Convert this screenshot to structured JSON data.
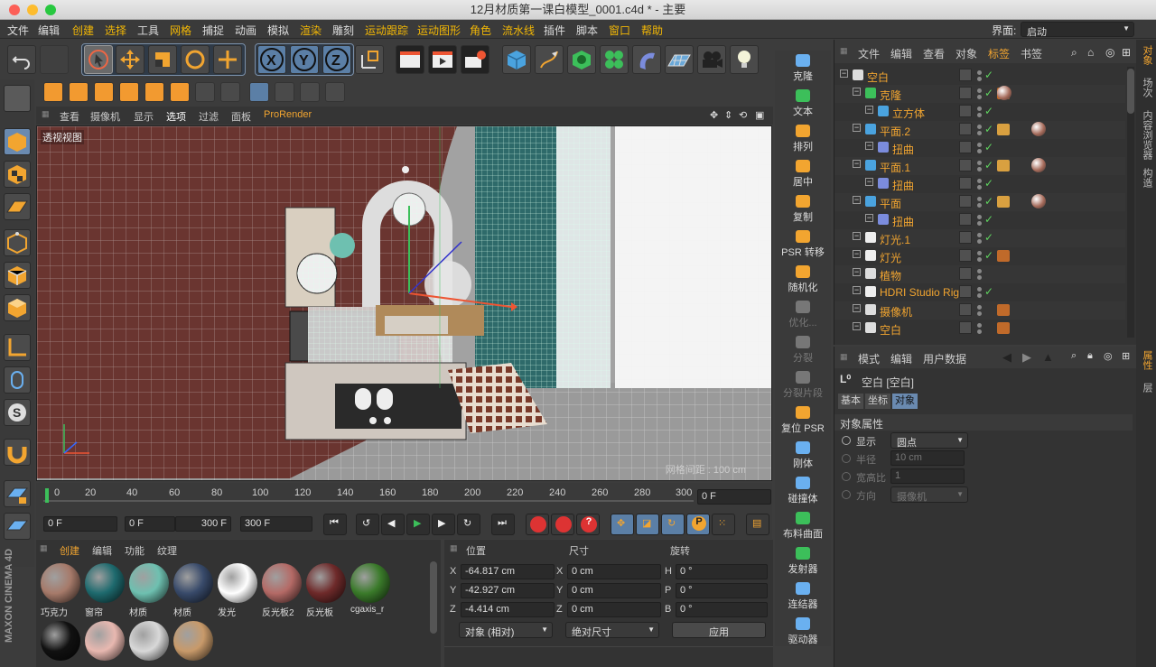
{
  "window": {
    "title": "12月材质第一课白模型_0001.c4d * - 主要"
  },
  "menu": [
    "文件",
    "编辑",
    "创建",
    "选择",
    "工具",
    "网格",
    "捕捉",
    "动画",
    "模拟",
    "渲染",
    "雕刻",
    "运动跟踪",
    "运动图形",
    "角色",
    "流水线",
    "插件",
    "脚本",
    "窗口",
    "帮助"
  ],
  "layout": {
    "label": "界面:",
    "value": "启动"
  },
  "viewport": {
    "menu": [
      "查看",
      "摄像机",
      "显示",
      "选项",
      "过滤",
      "面板",
      "ProRender"
    ],
    "label": "透视视图",
    "grid_spacing": "网格间距 : 100 cm"
  },
  "timeline": {
    "ticks": [
      "0",
      "20",
      "40",
      "60",
      "80",
      "100",
      "120",
      "140",
      "160",
      "180",
      "200",
      "220",
      "240",
      "260",
      "280",
      "300"
    ],
    "current": "0 F"
  },
  "transport": {
    "start": "0 F",
    "range_start": "0 F",
    "range_end": "300 F",
    "end": "300 F"
  },
  "materials": {
    "menu": [
      "创建",
      "编辑",
      "功能",
      "纹理"
    ],
    "items": [
      {
        "name": "巧克力",
        "color": "#a67a6a"
      },
      {
        "name": "窗帘",
        "color": "#1e6a6e"
      },
      {
        "name": "材质",
        "color": "#6ec0b0"
      },
      {
        "name": "材质",
        "color": "#384a6a"
      },
      {
        "name": "发光",
        "color": "#ffffff"
      },
      {
        "name": "反光板2",
        "color": "#b46a66"
      },
      {
        "name": "反光板",
        "color": "#6e2a2a"
      },
      {
        "name": "cgaxis_r",
        "color": "#3a7a2a"
      }
    ],
    "row2_colors": [
      "#111111",
      "#e8b8b0",
      "#d8d8d8",
      "#c89a6a"
    ]
  },
  "coords": {
    "headers": [
      "位置",
      "尺寸",
      "旋转"
    ],
    "rows": [
      {
        "a": "X",
        "av": "-64.817 cm",
        "b": "X",
        "bv": "0 cm",
        "c": "H",
        "cv": "0 °"
      },
      {
        "a": "Y",
        "av": "-42.927 cm",
        "b": "Y",
        "bv": "0 cm",
        "c": "P",
        "cv": "0 °"
      },
      {
        "a": "Z",
        "av": "-4.414 cm",
        "b": "Z",
        "bv": "0 cm",
        "c": "B",
        "cv": "0 °"
      }
    ],
    "mode": "对象 (相对)",
    "size_mode": "绝对尺寸",
    "apply": "应用"
  },
  "palette": [
    "克隆",
    "文本",
    "排列",
    "居中",
    "复制",
    "PSR 转移",
    "随机化",
    "优化...",
    "分裂",
    "分裂片段",
    "复位 PSR",
    "刚体",
    "碰撞体",
    "布料曲面",
    "发射器",
    "连结器",
    "驱动器"
  ],
  "palette_dim": [
    false,
    false,
    false,
    false,
    false,
    false,
    false,
    true,
    true,
    true,
    false,
    false,
    false,
    false,
    false,
    false,
    false
  ],
  "objects": {
    "menu": [
      "文件",
      "编辑",
      "查看",
      "对象",
      "标签",
      "书签"
    ],
    "rows": [
      {
        "name": "空白",
        "indent": 0,
        "icon": "L0"
      },
      {
        "name": "克隆",
        "indent": 1,
        "icon": "clone"
      },
      {
        "name": "立方体",
        "indent": 2,
        "icon": "cube"
      },
      {
        "name": "平面.2",
        "indent": 1,
        "icon": "plane"
      },
      {
        "name": "扭曲",
        "indent": 2,
        "icon": "bend"
      },
      {
        "name": "平面.1",
        "indent": 1,
        "icon": "plane"
      },
      {
        "name": "扭曲",
        "indent": 2,
        "icon": "bend"
      },
      {
        "name": "平面",
        "indent": 1,
        "icon": "plane"
      },
      {
        "name": "扭曲",
        "indent": 2,
        "icon": "bend"
      },
      {
        "name": "灯光.1",
        "indent": 1,
        "icon": "light"
      },
      {
        "name": "灯光",
        "indent": 1,
        "icon": "bulb"
      },
      {
        "name": "植物",
        "indent": 1,
        "icon": "L0"
      },
      {
        "name": "HDRI Studio Rig",
        "indent": 1,
        "icon": "hdri"
      },
      {
        "name": "摄像机",
        "indent": 1,
        "icon": "camera"
      },
      {
        "name": "空白",
        "indent": 1,
        "icon": "L0"
      }
    ]
  },
  "attributes": {
    "menu": [
      "模式",
      "编辑",
      "用户数据"
    ],
    "title": "空白 [空白]",
    "tabs": [
      "基本",
      "坐标",
      "对象"
    ],
    "section": "对象属性",
    "fields": [
      {
        "label": "显示",
        "value": "圆点"
      },
      {
        "label": "半径",
        "value": "10 cm"
      },
      {
        "label": "宽高比",
        "value": "1"
      },
      {
        "label": "方向",
        "value": "摄像机"
      }
    ]
  },
  "side_tabs": [
    "对象",
    "场次",
    "内容浏览器",
    "构造"
  ],
  "side_tabs2": [
    "属性",
    "层"
  ],
  "brand": "MAXON CINEMA 4D"
}
